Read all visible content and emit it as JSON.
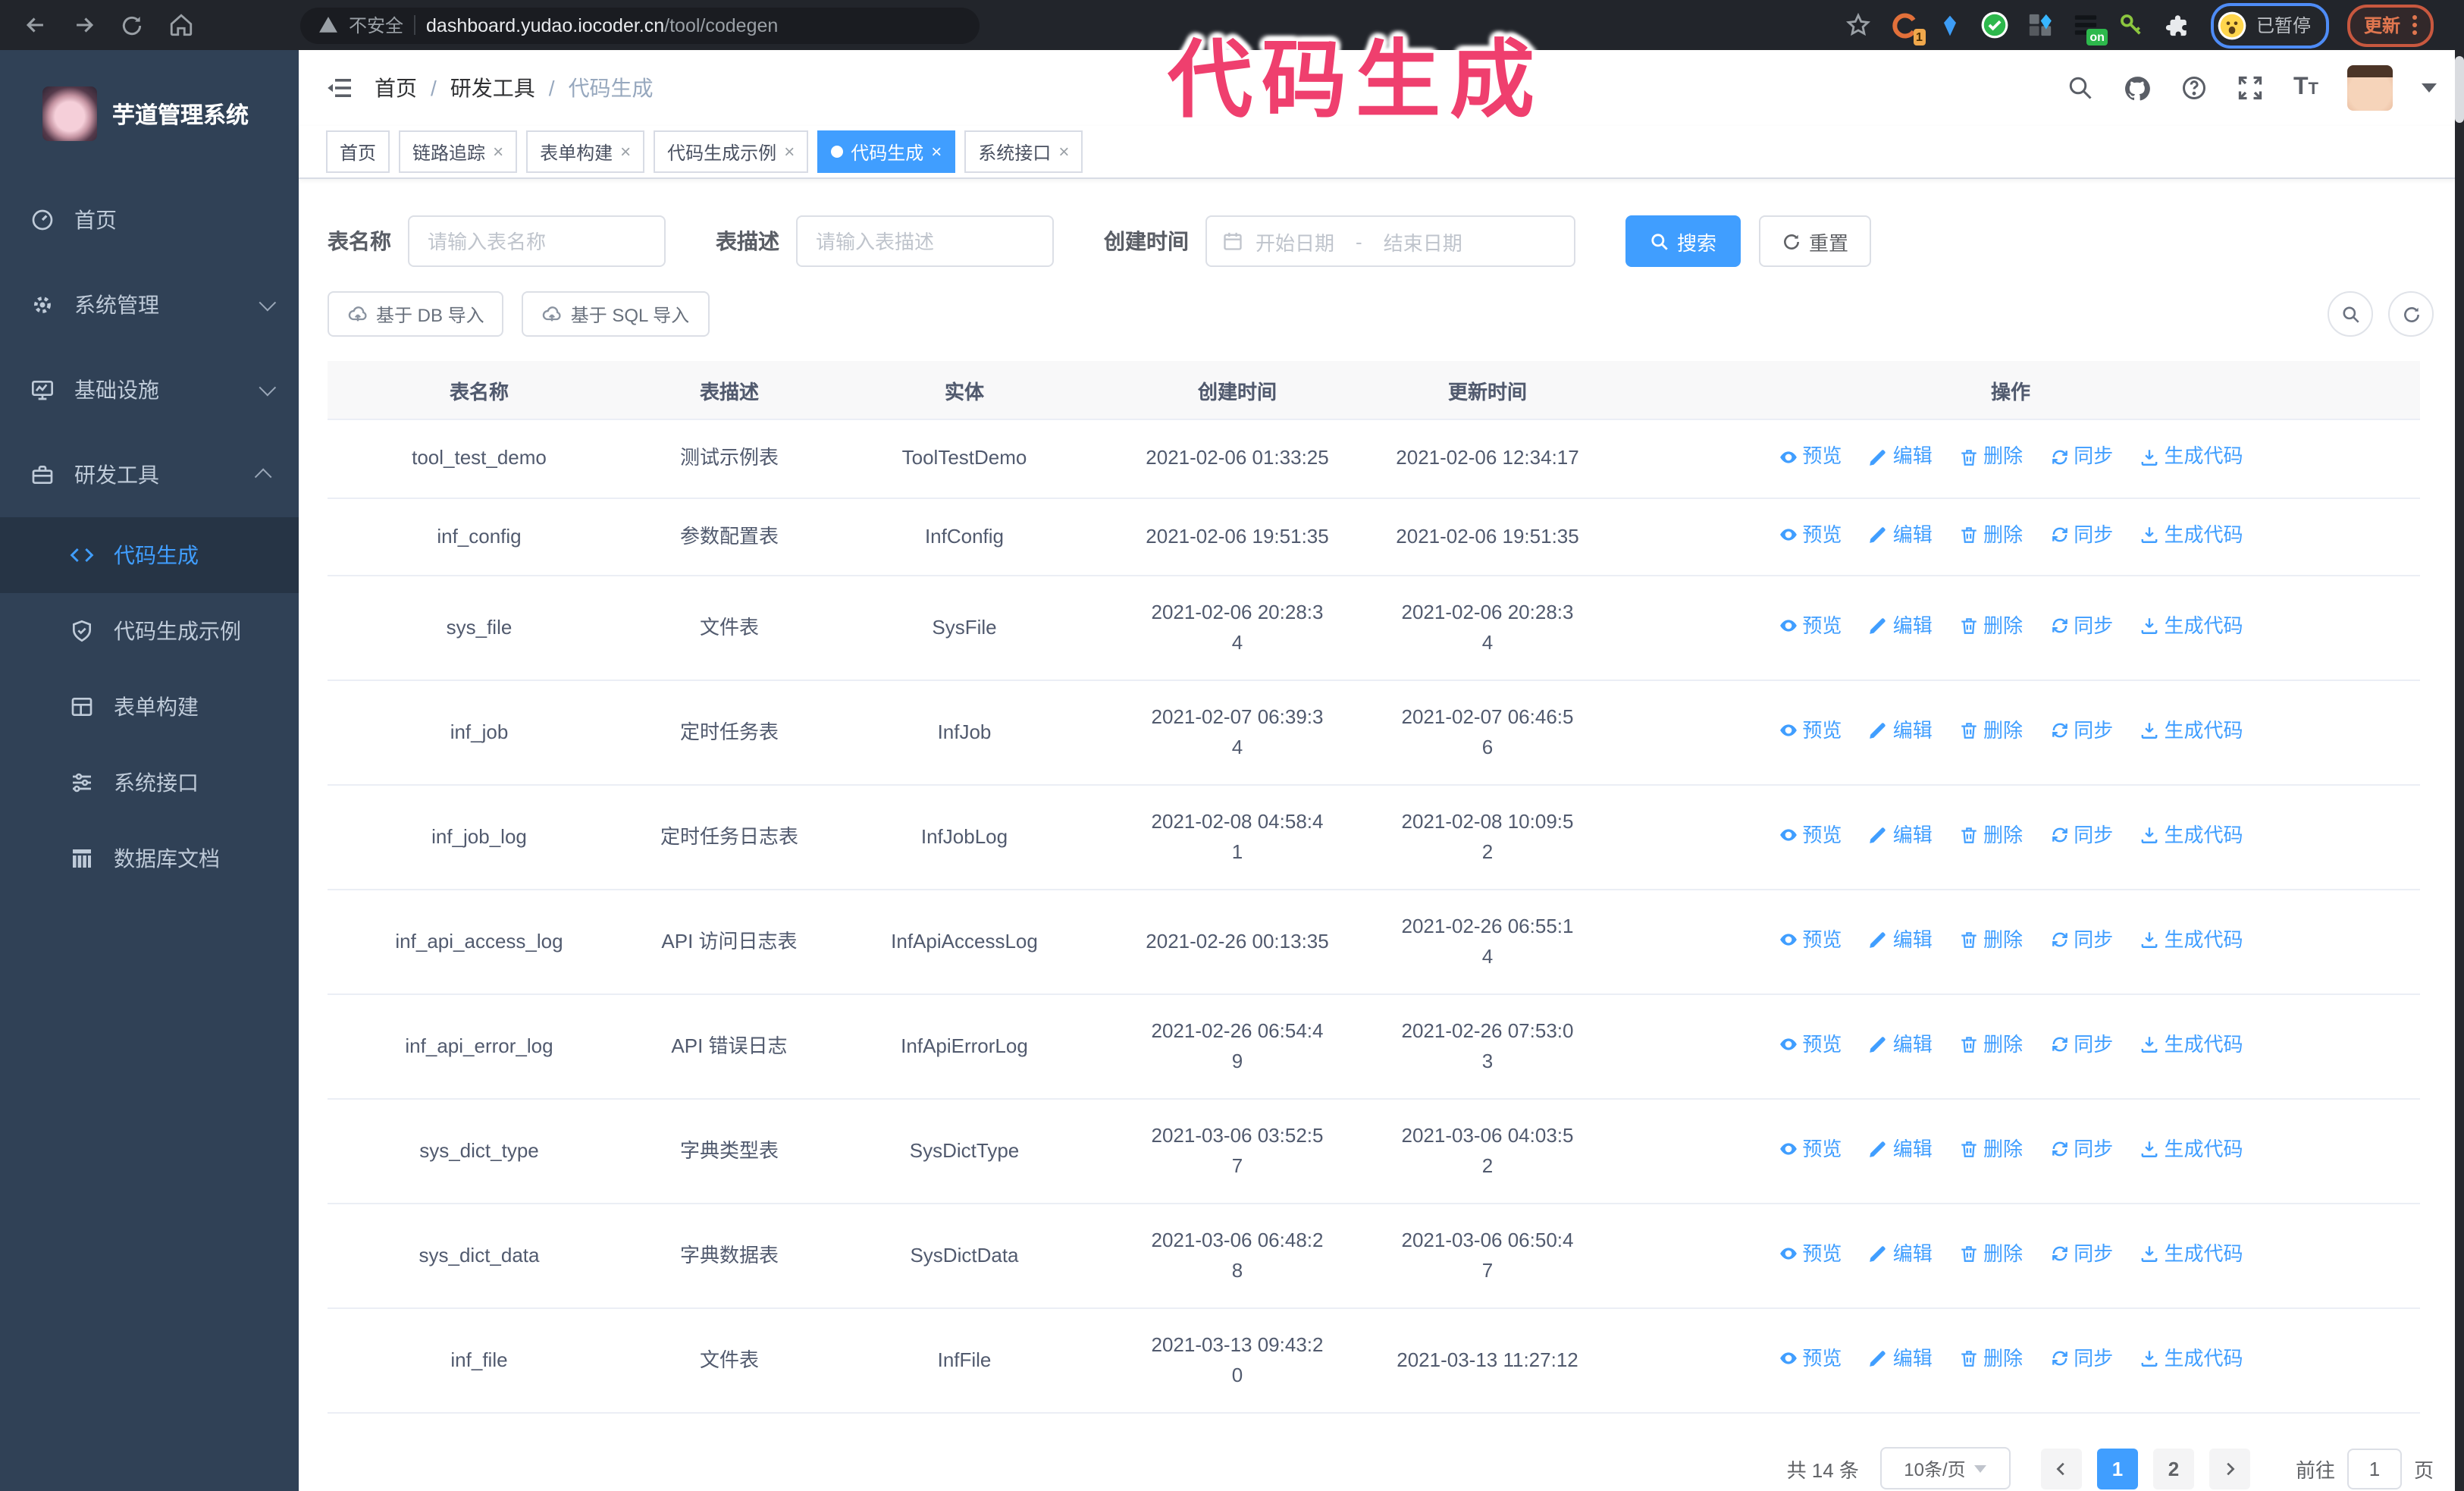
{
  "browser": {
    "security_label": "不安全",
    "url_host": "dashboard.yudao.iocoder.cn",
    "url_path": "/tool/codegen",
    "ext_badge_count": "1",
    "ext_badge_on": "on",
    "profile_badge": "已暂停",
    "update_label": "更新"
  },
  "annotation": {
    "text": "代码生成",
    "color": "#ef3f6e"
  },
  "sidebar": {
    "title": "芋道管理系统",
    "items": [
      {
        "label": "首页"
      },
      {
        "label": "系统管理"
      },
      {
        "label": "基础设施"
      },
      {
        "label": "研发工具"
      }
    ],
    "subitems": [
      {
        "label": "代码生成",
        "active": true
      },
      {
        "label": "代码生成示例"
      },
      {
        "label": "表单构建"
      },
      {
        "label": "系统接口"
      },
      {
        "label": "数据库文档"
      }
    ]
  },
  "header": {
    "breadcrumb": [
      "首页",
      "研发工具",
      "代码生成"
    ]
  },
  "tabs": [
    {
      "label": "首页"
    },
    {
      "label": "链路追踪"
    },
    {
      "label": "表单构建"
    },
    {
      "label": "代码生成示例"
    },
    {
      "label": "代码生成"
    },
    {
      "label": "系统接口"
    }
  ],
  "filters": {
    "name_label": "表名称",
    "name_placeholder": "请输入表名称",
    "desc_label": "表描述",
    "desc_placeholder": "请输入表描述",
    "time_label": "创建时间",
    "start_placeholder": "开始日期",
    "range_separator": "-",
    "end_placeholder": "结束日期",
    "search_label": "搜索",
    "reset_label": "重置"
  },
  "toolbar": {
    "import_db_label": "基于 DB 导入",
    "import_sql_label": "基于 SQL 导入"
  },
  "table": {
    "headers": [
      "表名称",
      "表描述",
      "实体",
      "创建时间",
      "更新时间",
      "操作"
    ],
    "actions": [
      "预览",
      "编辑",
      "删除",
      "同步",
      "生成代码"
    ],
    "rows": [
      {
        "name": "tool_test_demo",
        "desc": "测试示例表",
        "entity": "ToolTestDemo",
        "created": "2021-02-06 01:33:25",
        "updated": "2021-02-06 12:34:17"
      },
      {
        "name": "inf_config",
        "desc": "参数配置表",
        "entity": "InfConfig",
        "created": "2021-02-06 19:51:35",
        "updated": "2021-02-06 19:51:35"
      },
      {
        "name": "sys_file",
        "desc": "文件表",
        "entity": "SysFile",
        "created": "2021-02-06 20:28:3\n4",
        "updated": "2021-02-06 20:28:3\n4"
      },
      {
        "name": "inf_job",
        "desc": "定时任务表",
        "entity": "InfJob",
        "created": "2021-02-07 06:39:3\n4",
        "updated": "2021-02-07 06:46:5\n6"
      },
      {
        "name": "inf_job_log",
        "desc": "定时任务日志表",
        "entity": "InfJobLog",
        "created": "2021-02-08 04:58:4\n1",
        "updated": "2021-02-08 10:09:5\n2"
      },
      {
        "name": "inf_api_access_log",
        "desc": "API 访问日志表",
        "entity": "InfApiAccessLog",
        "created": "2021-02-26 00:13:35",
        "updated": "2021-02-26 06:55:1\n4"
      },
      {
        "name": "inf_api_error_log",
        "desc": "API 错误日志",
        "entity": "InfApiErrorLog",
        "created": "2021-02-26 06:54:4\n9",
        "updated": "2021-02-26 07:53:0\n3"
      },
      {
        "name": "sys_dict_type",
        "desc": "字典类型表",
        "entity": "SysDictType",
        "created": "2021-03-06 03:52:5\n7",
        "updated": "2021-03-06 04:03:5\n2"
      },
      {
        "name": "sys_dict_data",
        "desc": "字典数据表",
        "entity": "SysDictData",
        "created": "2021-03-06 06:48:2\n8",
        "updated": "2021-03-06 06:50:4\n7"
      },
      {
        "name": "inf_file",
        "desc": "文件表",
        "entity": "InfFile",
        "created": "2021-03-13 09:43:2\n0",
        "updated": "2021-03-13 11:27:12"
      }
    ]
  },
  "pagination": {
    "total": "共 14 条",
    "page_size": "10条/页",
    "pages": [
      "1",
      "2"
    ],
    "active_page": "1",
    "goto_label": "前往",
    "goto_value": "1",
    "goto_suffix": "页"
  },
  "colors": {
    "accent": "#409eff",
    "sidebar_bg": "#304156",
    "annotation": "#ef3f6e"
  },
  "icons": {
    "back-icon": "←",
    "forward-icon": "→",
    "reload-icon": "⟳",
    "home-icon": "⌂",
    "warning-icon": "⚠",
    "bookmark-star-icon": "☆",
    "extensions-puzzle-icon": "puzzle",
    "search-icon": "magnifier",
    "github-icon": "octocat",
    "help-icon": "?",
    "fullscreen-icon": "expand",
    "font-size-icon": "Tt",
    "hamburger-icon": "menu-fold",
    "dashboard-icon": "gauge",
    "gear-icon": "gear",
    "monitor-icon": "screen",
    "toolbox-icon": "briefcase",
    "code-icon": "</>",
    "shield-check-icon": "shield",
    "form-icon": "grid",
    "sliders-icon": "sliders",
    "columns-icon": "columns",
    "calendar-icon": "calendar",
    "upload-cloud-icon": "cloud-up",
    "refresh-icon": "refresh",
    "eye-icon": "eye",
    "edit-icon": "pencil",
    "delete-icon": "trash",
    "sync-icon": "sync",
    "download-icon": "download"
  }
}
